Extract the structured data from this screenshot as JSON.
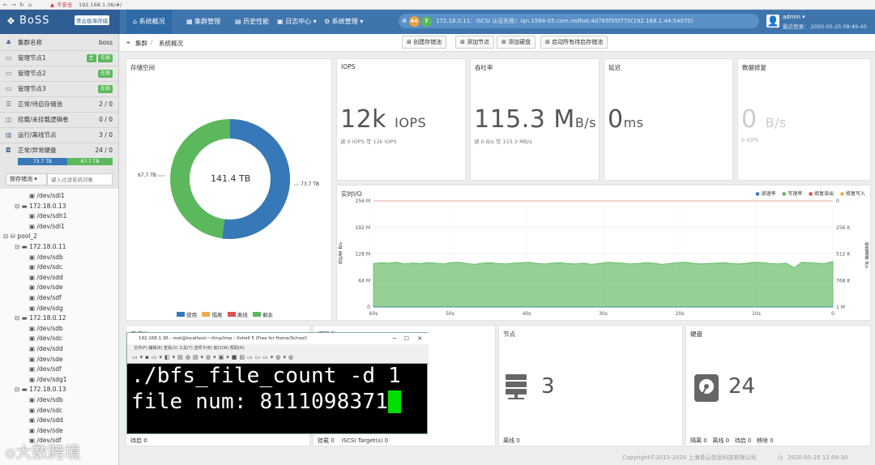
{
  "browser": {
    "url": "192.168.1.36/#/",
    "security": "不安全"
  },
  "brand": {
    "logo_text": "BoSS",
    "product_tag": "青云极海存储"
  },
  "nav": {
    "items": [
      {
        "label": "系统概况",
        "icon": "home-icon"
      },
      {
        "label": "集群管理",
        "icon": "grid-icon"
      },
      {
        "label": "历史性能",
        "icon": "chart-icon"
      },
      {
        "label": "日志中心 ▾",
        "icon": "log-icon"
      },
      {
        "label": "系统管理 ▾",
        "icon": "gear-icon"
      }
    ],
    "alert_count_a": "44",
    "alert_count_b": "7",
    "status_text": "172.18.0.11：iSCSI 认证失败！iqn.1994-05.com.redhat:4d765f95f770(192.168.1.44:54070)",
    "user": "admin ▾",
    "last_login": "最近登录：  2020-05-25 08:49:40",
    "colors": {
      "nav_bg": "#3f75ad",
      "badge_orange": "#f0a030",
      "badge_green": "#5cb85c"
    }
  },
  "sidebar": {
    "summary": [
      {
        "label": "集群名称",
        "value": "boss",
        "icon": "cluster-icon"
      },
      {
        "label": "管理节点1",
        "badges": [
          "主",
          "在线"
        ],
        "icon": "monitor-icon"
      },
      {
        "label": "管理节点2",
        "badges": [
          "在线"
        ],
        "icon": "monitor-icon"
      },
      {
        "label": "管理节点3",
        "badges": [
          "在线"
        ],
        "icon": "monitor-icon"
      },
      {
        "label": "正常/待启存储池",
        "value": "2 / 0",
        "icon": "pool-icon"
      },
      {
        "label": "挂载/未挂载逻辑卷",
        "value": "0 / 0",
        "icon": "volume-icon"
      },
      {
        "label": "运行/离线节点",
        "value": "3 / 0",
        "icon": "node-icon"
      },
      {
        "label": "正常/异常硬盘",
        "value": "24 / 0",
        "icon": "disk-icon"
      }
    ],
    "capacity_used": "73.7 TB",
    "capacity_free": "67.7 TB",
    "filter_select": "按存储池 ▾",
    "filter_placeholder": "键入过滤系统对象",
    "tree": [
      "/dev/sdi1",
      "172.18.0.13",
      "/dev/sdh1",
      "/dev/sdi1",
      "pool_2",
      "172.18.0.11",
      "/dev/sdb",
      "/dev/sdc",
      "/dev/sdd",
      "/dev/sde",
      "/dev/sdf",
      "/dev/sdg",
      "172.18.0.12",
      "/dev/sdb",
      "/dev/sdc",
      "/dev/sdd",
      "/dev/sde",
      "/dev/sdf",
      "/dev/sdg1",
      "172.18.0.13",
      "/dev/sdb",
      "/dev/sdc",
      "/dev/sdd",
      "/dev/sde",
      "/dev/sdf"
    ]
  },
  "breadcrumb": {
    "root": "集群",
    "current": "系统概况"
  },
  "toolbar": {
    "create_pool": "创建存储池",
    "add_node": "添加节点",
    "add_disk": "添加硬盘",
    "start_all": "启动所有待启存储池"
  },
  "storage": {
    "title": "存储空间",
    "total": "141.4 TB",
    "left_label": "67.7 TB",
    "right_label": "73.7 TB",
    "legend": [
      "使用",
      "隔离",
      "离线",
      "剩余"
    ],
    "legend_colors": [
      "#3778b8",
      "#f0ad4e",
      "#d9534f",
      "#5cb85c"
    ],
    "used_fraction": 0.521
  },
  "iops": {
    "title": "IOPS",
    "value": "12k",
    "unit": "IOPS",
    "detail": "读 0 IOPS  写 12k IOPS"
  },
  "throughput": {
    "title": "吞吐率",
    "value": "115.3 M",
    "unit": "B/s",
    "detail": "读 0 B/s  写 115.3 MB/s"
  },
  "latency": {
    "title": "延迟",
    "value": "0",
    "unit": "ms"
  },
  "repair": {
    "title": "数据修复",
    "value": "0",
    "unit": "B/s",
    "detail": "0 IOPS"
  },
  "realtime": {
    "title": "实时I/O",
    "legend": [
      "读速率",
      "写速率",
      "修复读出",
      "修复写入"
    ],
    "legend_colors": [
      "#3778b8",
      "#5cb85c",
      "#d9534f",
      "#f0ad4e"
    ],
    "ylabel_left": "吞吐率 B/s",
    "ylabel_right": "修复速率 B/s"
  },
  "chart_data": {
    "type": "area",
    "title": "实时I/O",
    "xlabel": "",
    "ylabel": "吞吐率 B/s",
    "x_ticks": [
      "60s",
      "50s",
      "40s",
      "30s",
      "20s",
      "10s",
      "0"
    ],
    "y_left_ticks": [
      "0",
      "64 M",
      "128 M",
      "192 M",
      "256 M"
    ],
    "y_right_ticks": [
      "1 M",
      "768 K",
      "512 K",
      "256 K",
      "0"
    ],
    "ylim": [
      0,
      256
    ],
    "grid": true,
    "legend_position": "top-right",
    "series": [
      {
        "name": "写速率",
        "values": [
          105,
          107,
          106,
          108,
          104,
          106,
          105,
          107,
          106,
          104,
          107,
          108,
          105,
          103,
          106,
          107,
          105,
          104,
          106,
          107,
          108,
          105,
          104,
          106,
          107,
          105,
          104,
          106,
          103,
          105,
          108,
          107,
          106,
          104,
          105,
          107,
          106,
          103,
          105,
          107,
          108,
          106,
          104,
          105,
          106,
          107,
          105,
          104,
          106,
          108,
          107,
          105,
          104,
          106,
          95,
          108,
          107,
          106,
          105,
          110
        ]
      },
      {
        "name": "读速率",
        "values": [
          0,
          0,
          0,
          0,
          0,
          0,
          0,
          0,
          0,
          0,
          0,
          0,
          0,
          0,
          0,
          0,
          0,
          0,
          0,
          0,
          0,
          0,
          0,
          0,
          0,
          0,
          0,
          0,
          0,
          0,
          0,
          0,
          0,
          0,
          0,
          0,
          0,
          0,
          0,
          0,
          0,
          0,
          0,
          0,
          0,
          0,
          0,
          0,
          0,
          0,
          0,
          0,
          0,
          0,
          0,
          0,
          0,
          0,
          0,
          0
        ]
      }
    ]
  },
  "lower": {
    "pool_title": "存储池",
    "pool_footer": "待启 0",
    "volume_title": "逻辑卷",
    "volume_footer": "挂载 0    iSCSI Target(s) 0",
    "node_title": "节点",
    "node_value": "3",
    "node_footer": "离线 0",
    "disk_title": "硬盘",
    "disk_value": "24",
    "disk_footer": "隔离 0   离线 0   待启 0   移除 0"
  },
  "terminal": {
    "title": "192.168.1.36 - root@localhost:~/tmp/tmp - Xshell 5 (Free for Home/School)",
    "menu": "文件(F)   编辑(E)   查看(V)   工具(T)   选项卡(B)   窗口(W)   帮助(H)",
    "line1": "./bfs_file_count -d 1",
    "line2": "file num: 8111098371"
  },
  "footer": {
    "copyright": "Copyright©2015-2020 上海青云信息科技有限公司",
    "time": "2020-05-25 12:09:30"
  },
  "watermark": "大数跨境"
}
